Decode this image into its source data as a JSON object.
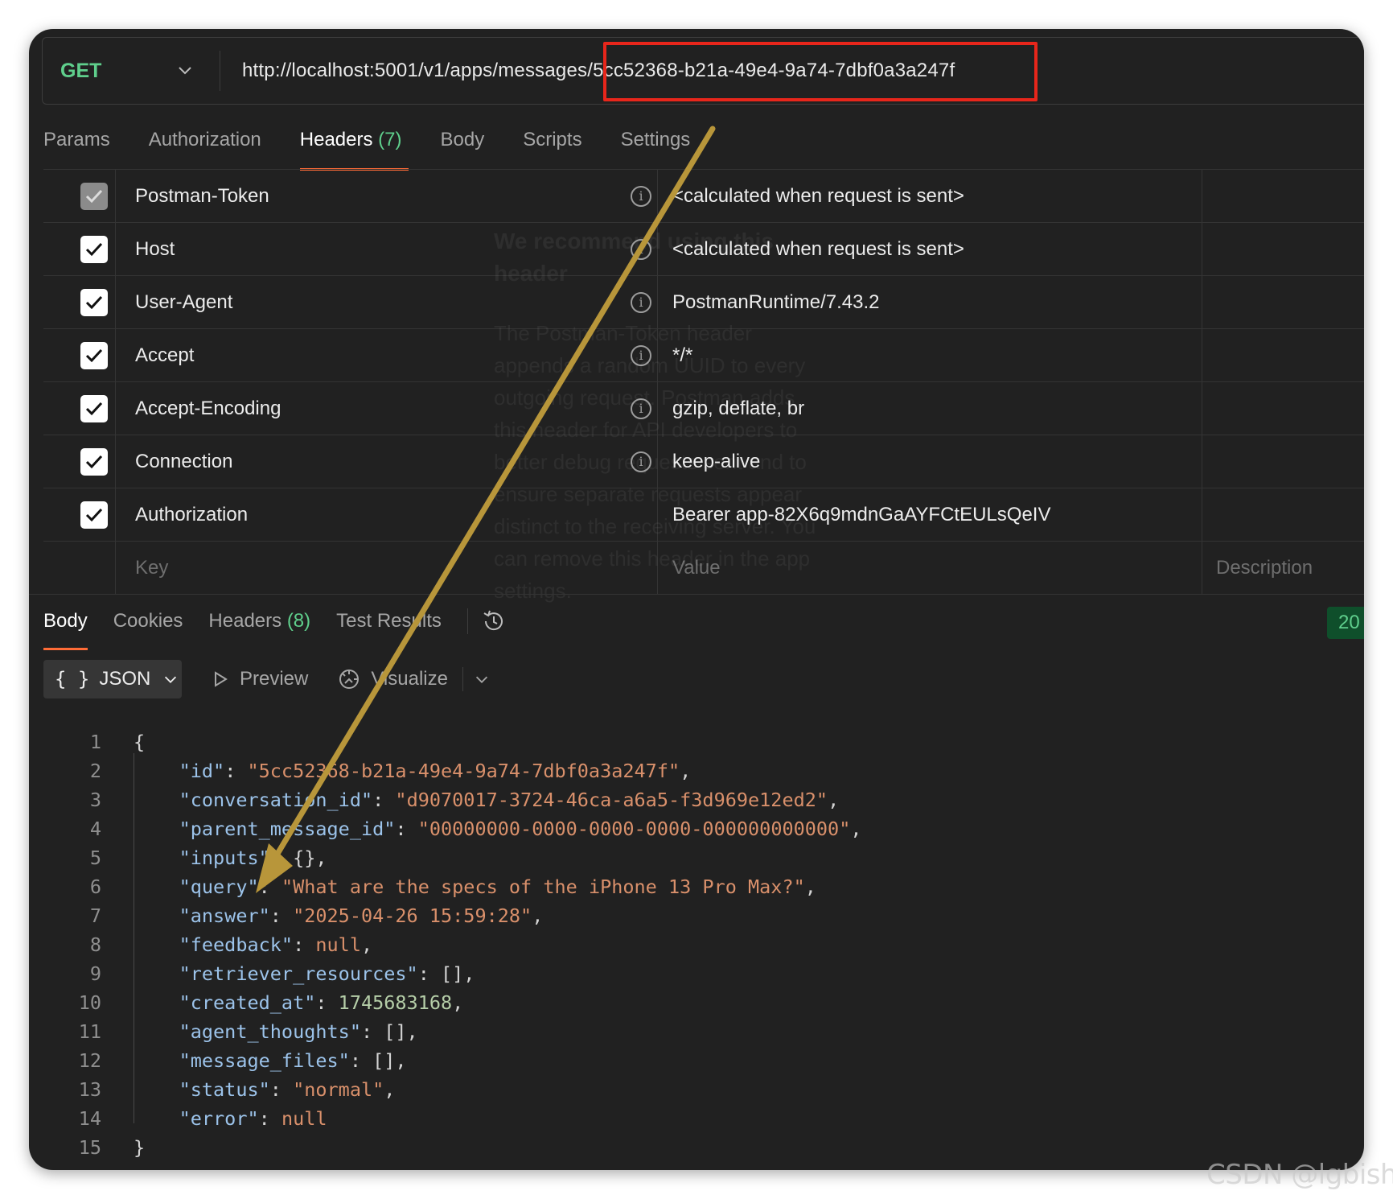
{
  "request": {
    "method": "GET",
    "url_base": "http://localhost:5001/v1/apps/messages",
    "url_id": "/5cc52368-b21a-49e4-9a74-7dbf0a3a247f"
  },
  "req_tabs": [
    {
      "label": "Params"
    },
    {
      "label": "Authorization"
    },
    {
      "label": "Headers",
      "count": "(7)"
    },
    {
      "label": "Body"
    },
    {
      "label": "Scripts"
    },
    {
      "label": "Settings"
    }
  ],
  "headers": [
    {
      "key": "Postman-Token",
      "value": "<calculated when request is sent>",
      "info": "i"
    },
    {
      "key": "Host",
      "value": "<calculated when request is sent>",
      "info": "i"
    },
    {
      "key": "User-Agent",
      "value": "PostmanRuntime/7.43.2",
      "info": "i"
    },
    {
      "key": "Accept",
      "value": "*/*",
      "info": "i"
    },
    {
      "key": "Accept-Encoding",
      "value": "gzip, deflate, br",
      "info": "i"
    },
    {
      "key": "Connection",
      "value": "keep-alive",
      "info": "i"
    },
    {
      "key": "Authorization",
      "value": "Bearer app-82X6q9mdnGaAYFCtEULsQeIV"
    }
  ],
  "headers_placeholder": {
    "key": "Key",
    "value": "Value",
    "description": "Description"
  },
  "tooltip": {
    "title": "We recommend using this header",
    "body": "The Postman-Token header appends a random UUID to every outgoing request. Postman adds this header for API developers to better debug requests sent and to ensure separate requests appear distinct to the receiving server. You can remove this header in the app settings."
  },
  "resp_tabs": [
    {
      "label": "Body"
    },
    {
      "label": "Cookies"
    },
    {
      "label": "Headers",
      "count": "(8)"
    },
    {
      "label": "Test Results"
    }
  ],
  "status_badge": "20",
  "format": {
    "selected": "JSON",
    "braces": "{ }",
    "preview": "Preview",
    "visualize": "Visualize"
  },
  "code_lines": [
    {
      "n": "1",
      "parts": [
        [
          "p",
          "{"
        ]
      ]
    },
    {
      "n": "2",
      "parts": [
        [
          "p",
          "    "
        ],
        [
          "k",
          "\"id\""
        ],
        [
          "p",
          ": "
        ],
        [
          "s",
          "\"5cc52368-b21a-49e4-9a74-7dbf0a3a247f\""
        ],
        [
          "p",
          ","
        ]
      ]
    },
    {
      "n": "3",
      "parts": [
        [
          "p",
          "    "
        ],
        [
          "k",
          "\"conversation_id\""
        ],
        [
          "p",
          ": "
        ],
        [
          "s",
          "\"d9070017-3724-46ca-a6a5-f3d969e12ed2\""
        ],
        [
          "p",
          ","
        ]
      ]
    },
    {
      "n": "4",
      "parts": [
        [
          "p",
          "    "
        ],
        [
          "k",
          "\"parent_message_id\""
        ],
        [
          "p",
          ": "
        ],
        [
          "s",
          "\"00000000-0000-0000-0000-000000000000\""
        ],
        [
          "p",
          ","
        ]
      ]
    },
    {
      "n": "5",
      "parts": [
        [
          "p",
          "    "
        ],
        [
          "k",
          "\"inputs\""
        ],
        [
          "p",
          ": {},"
        ]
      ]
    },
    {
      "n": "6",
      "parts": [
        [
          "p",
          "    "
        ],
        [
          "k",
          "\"query\""
        ],
        [
          "p",
          ": "
        ],
        [
          "s",
          "\"What are the specs of the iPhone 13 Pro Max?\""
        ],
        [
          "p",
          ","
        ]
      ]
    },
    {
      "n": "7",
      "parts": [
        [
          "p",
          "    "
        ],
        [
          "k",
          "\"answer\""
        ],
        [
          "p",
          ": "
        ],
        [
          "s",
          "\"2025-04-26 15:59:28\""
        ],
        [
          "p",
          ","
        ]
      ]
    },
    {
      "n": "8",
      "parts": [
        [
          "p",
          "    "
        ],
        [
          "k",
          "\"feedback\""
        ],
        [
          "p",
          ": "
        ],
        [
          "s",
          "null"
        ],
        [
          "p",
          ","
        ]
      ]
    },
    {
      "n": "9",
      "parts": [
        [
          "p",
          "    "
        ],
        [
          "k",
          "\"retriever_resources\""
        ],
        [
          "p",
          ": [],"
        ]
      ]
    },
    {
      "n": "10",
      "parts": [
        [
          "p",
          "    "
        ],
        [
          "k",
          "\"created_at\""
        ],
        [
          "p",
          ": "
        ],
        [
          "n",
          "1745683168"
        ],
        [
          "p",
          ","
        ]
      ]
    },
    {
      "n": "11",
      "parts": [
        [
          "p",
          "    "
        ],
        [
          "k",
          "\"agent_thoughts\""
        ],
        [
          "p",
          ": [],"
        ]
      ]
    },
    {
      "n": "12",
      "parts": [
        [
          "p",
          "    "
        ],
        [
          "k",
          "\"message_files\""
        ],
        [
          "p",
          ": [],"
        ]
      ]
    },
    {
      "n": "13",
      "parts": [
        [
          "p",
          "    "
        ],
        [
          "k",
          "\"status\""
        ],
        [
          "p",
          ": "
        ],
        [
          "s",
          "\"normal\""
        ],
        [
          "p",
          ","
        ]
      ]
    },
    {
      "n": "14",
      "parts": [
        [
          "p",
          "    "
        ],
        [
          "k",
          "\"error\""
        ],
        [
          "p",
          ": "
        ],
        [
          "s",
          "null"
        ]
      ]
    },
    {
      "n": "15",
      "parts": [
        [
          "p",
          "}"
        ]
      ]
    }
  ],
  "watermark": "CSDN @lgbisha",
  "colors": {
    "accent": "#ff6c37",
    "method": "#5fcf8c",
    "highlight_box": "#e8261b",
    "arrow": "#b8963a"
  }
}
